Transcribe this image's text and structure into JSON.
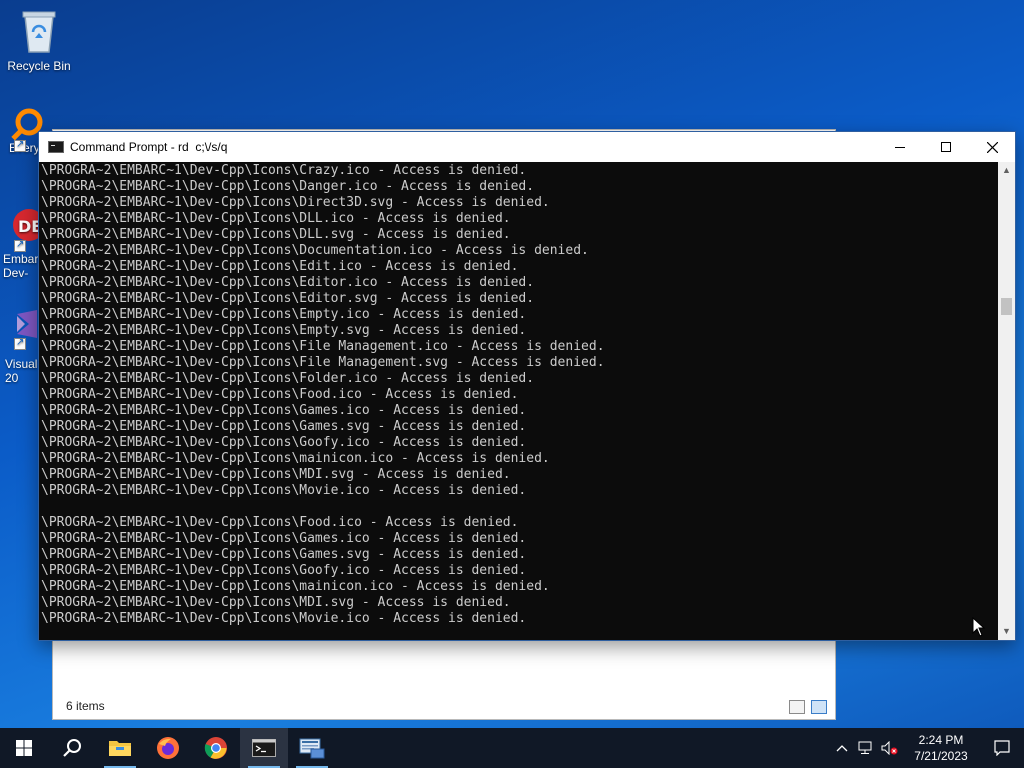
{
  "desktop": {
    "icons": [
      {
        "label": "Recycle Bin",
        "icon": "recycle-bin-icon"
      },
      {
        "label": "Every",
        "icon": "everything-search-icon"
      },
      {
        "label": "Embar\nDev-",
        "icon": "embarcadero-devcpp-icon"
      },
      {
        "label": "Visual\n20",
        "icon": "visual-studio-icon"
      }
    ]
  },
  "explorer": {
    "status_items": "6 items",
    "view_buttons": [
      "details-view-icon",
      "large-icons-view-icon"
    ]
  },
  "cmd": {
    "title": "Command Prompt - rd  c;\\/s/q",
    "buttons": {
      "minimize": "minimize-icon",
      "maximize": "maximize-icon",
      "close": "close-icon"
    },
    "lines": [
      "\\PROGRA~2\\EMBARC~1\\Dev-Cpp\\Icons\\Crazy.ico - Access is denied.",
      "\\PROGRA~2\\EMBARC~1\\Dev-Cpp\\Icons\\Danger.ico - Access is denied.",
      "\\PROGRA~2\\EMBARC~1\\Dev-Cpp\\Icons\\Direct3D.svg - Access is denied.",
      "\\PROGRA~2\\EMBARC~1\\Dev-Cpp\\Icons\\DLL.ico - Access is denied.",
      "\\PROGRA~2\\EMBARC~1\\Dev-Cpp\\Icons\\DLL.svg - Access is denied.",
      "\\PROGRA~2\\EMBARC~1\\Dev-Cpp\\Icons\\Documentation.ico - Access is denied.",
      "\\PROGRA~2\\EMBARC~1\\Dev-Cpp\\Icons\\Edit.ico - Access is denied.",
      "\\PROGRA~2\\EMBARC~1\\Dev-Cpp\\Icons\\Editor.ico - Access is denied.",
      "\\PROGRA~2\\EMBARC~1\\Dev-Cpp\\Icons\\Editor.svg - Access is denied.",
      "\\PROGRA~2\\EMBARC~1\\Dev-Cpp\\Icons\\Empty.ico - Access is denied.",
      "\\PROGRA~2\\EMBARC~1\\Dev-Cpp\\Icons\\Empty.svg - Access is denied.",
      "\\PROGRA~2\\EMBARC~1\\Dev-Cpp\\Icons\\File Management.ico - Access is denied.",
      "\\PROGRA~2\\EMBARC~1\\Dev-Cpp\\Icons\\File Management.svg - Access is denied.",
      "\\PROGRA~2\\EMBARC~1\\Dev-Cpp\\Icons\\Folder.ico - Access is denied.",
      "\\PROGRA~2\\EMBARC~1\\Dev-Cpp\\Icons\\Food.ico - Access is denied.",
      "\\PROGRA~2\\EMBARC~1\\Dev-Cpp\\Icons\\Games.ico - Access is denied.",
      "\\PROGRA~2\\EMBARC~1\\Dev-Cpp\\Icons\\Games.svg - Access is denied.",
      "\\PROGRA~2\\EMBARC~1\\Dev-Cpp\\Icons\\Goofy.ico - Access is denied.",
      "\\PROGRA~2\\EMBARC~1\\Dev-Cpp\\Icons\\mainicon.ico - Access is denied.",
      "\\PROGRA~2\\EMBARC~1\\Dev-Cpp\\Icons\\MDI.svg - Access is denied.",
      "\\PROGRA~2\\EMBARC~1\\Dev-Cpp\\Icons\\Movie.ico - Access is denied.",
      "",
      "\\PROGRA~2\\EMBARC~1\\Dev-Cpp\\Icons\\Food.ico - Access is denied.",
      "\\PROGRA~2\\EMBARC~1\\Dev-Cpp\\Icons\\Games.ico - Access is denied.",
      "\\PROGRA~2\\EMBARC~1\\Dev-Cpp\\Icons\\Games.svg - Access is denied.",
      "\\PROGRA~2\\EMBARC~1\\Dev-Cpp\\Icons\\Goofy.ico - Access is denied.",
      "\\PROGRA~2\\EMBARC~1\\Dev-Cpp\\Icons\\mainicon.ico - Access is denied.",
      "\\PROGRA~2\\EMBARC~1\\Dev-Cpp\\Icons\\MDI.svg - Access is denied.",
      "\\PROGRA~2\\EMBARC~1\\Dev-Cpp\\Icons\\Movie.ico - Access is denied."
    ]
  },
  "taskbar": {
    "items": [
      "start-icon",
      "search-icon",
      "file-explorer-icon",
      "firefox-icon",
      "chrome-icon",
      "command-prompt-icon",
      "network-tool-icon"
    ],
    "time": "2:24 PM",
    "date": "7/21/2023"
  },
  "colors": {
    "desktop": "#0b5cc8",
    "console_bg": "#0c0c0c",
    "console_fg": "#cccccc",
    "taskbar": "#101826"
  }
}
